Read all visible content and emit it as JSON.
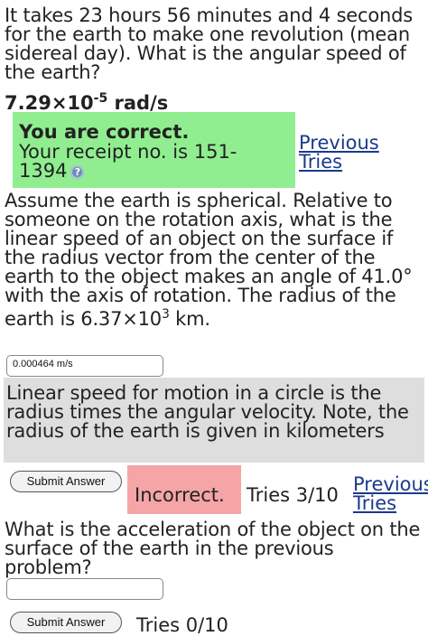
{
  "question1": {
    "text": "It takes 23 hours 56 minutes and 4 seconds for the earth to make one revolution (mean sidereal day). What is the angular speed of the earth?",
    "answer_mantissa": "7.29×10",
    "answer_exponent": "-5",
    "answer_unit": " rad/s"
  },
  "feedback1": {
    "title": "You are correct.",
    "receipt": "Your receipt no. is 151-1394",
    "help_icon": "help-icon",
    "previous_tries": "Previous Tries"
  },
  "question2": {
    "text": "Assume the earth is spherical. Relative to someone on the rotation axis, what is the linear speed of an object on the surface if the radius vector from the center of the earth to the object makes an angle of 41.0° with the axis of rotation. The radius of the earth is ",
    "radius_mantissa": "6.37×10",
    "radius_exponent": "3",
    "radius_unit": " km."
  },
  "answer2": {
    "value": "0.000464 m/s"
  },
  "hint2": {
    "text": "Linear speed for motion in a circle is the radius times the angular velocity. Note, the radius of the earth is given in kilometers"
  },
  "controls2": {
    "submit_label": "Submit Answer",
    "status": "Incorrect.",
    "tries": "Tries 3/10",
    "previous_tries": "Previous Tries"
  },
  "question3": {
    "text": "What is the acceleration of the object on the surface of the earth in the previous problem?"
  },
  "answer3": {
    "value": ""
  },
  "controls3": {
    "submit_label": "Submit Answer",
    "tries": "Tries 0/10"
  },
  "colors": {
    "correct_bg": "#90ee90",
    "incorrect_bg": "#f5a5a5",
    "hint_bg": "#dedede",
    "link": "#1a3a8e"
  }
}
